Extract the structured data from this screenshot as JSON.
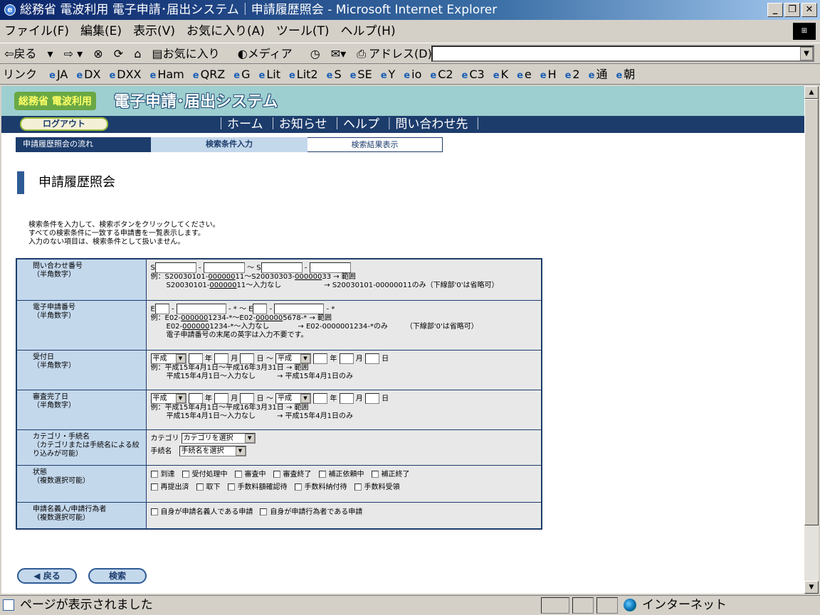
{
  "window": {
    "title": "総務省 電波利用 電子申請･届出システム｜申請履歴照会 - Microsoft Internet Explorer"
  },
  "menu": [
    "ファイル(F)",
    "編集(E)",
    "表示(V)",
    "お気に入り(A)",
    "ツール(T)",
    "ヘルプ(H)"
  ],
  "toolbar": {
    "back": "戻る",
    "favorites": "お気に入り",
    "media": "メディア",
    "address_label": "アドレス(D)",
    "address_value": ""
  },
  "links": {
    "label": "リンク",
    "items": [
      "JA",
      "DX",
      "DXX",
      "Ham",
      "QRZ",
      "G",
      "Lit",
      "Lit2",
      "S",
      "SE",
      "Y",
      "io",
      "C2",
      "C3",
      "K",
      "e",
      "H",
      "2",
      "通",
      "朝"
    ]
  },
  "site": {
    "logo_small_a": "総務省",
    "logo_small_b": "電波利用",
    "logo_main": "電子申請･届出システム",
    "logout": "ログアウト",
    "nav": "｜ホーム ｜お知らせ ｜ヘルプ ｜問い合わせ先 ｜"
  },
  "flow": {
    "s1": "申請履歴照会の流れ",
    "s2": "検索条件入力",
    "s3": "検索結果表示"
  },
  "page": {
    "title": "申請履歴照会",
    "intro": [
      "検索条件を入力して、検索ボタンをクリックしてください。",
      "すべての検索条件に一致する申請書を一覧表示します。",
      "入力のない項目は、検索条件として扱いません。"
    ]
  },
  "form": {
    "inquiry": {
      "label": "問い合わせ番号",
      "sub": "（半角数字）",
      "p": "S",
      "tilde": "～",
      "ex1": "例：S20030101-",
      "ex1u": "000000",
      "ex1b": "11～S20030303-",
      "ex1u2": "000000",
      "ex1c": "33 → 範囲",
      "ex2a": "S20030101-",
      "ex2u": "000000",
      "ex2b": "11～入力なし　　　　　　→ S20030101-00000011のみ（下線部'0'は省略可）"
    },
    "eapp": {
      "label": "電子申請番号",
      "sub": "（半角数字）",
      "mid": "- * ～ E",
      "p": "E",
      "tail": "- *",
      "ex1": "例：E02-",
      "ex1u": "000000",
      "ex1b": "1234-*～E02-",
      "ex1u2": "000000",
      "ex1c": "5678-* → 範囲",
      "ex2a": "E02-",
      "ex2u": "000000",
      "ex2b": "1234-*～入力なし　　　　→ E02-0000001234-*のみ　　　（下線部'0'は省略可）",
      "note": "電子申請番号の末尾の英字は入力不要です。"
    },
    "receipt": {
      "label": "受付日",
      "sub": "（半角数字）",
      "era": "平成",
      "y": "年",
      "m": "月",
      "d": "日",
      "tilde": "～",
      "ex1": "例：平成15年4月1日～平成16年3月31日 → 範囲",
      "ex2": "平成15年4月1日～入力なし　　　→ 平成15年4月1日のみ"
    },
    "review": {
      "label": "審査完了日",
      "sub": "（半角数字）",
      "era": "平成",
      "y": "年",
      "m": "月",
      "d": "日",
      "tilde": "～",
      "ex1": "例：平成15年4月1日～平成16年3月31日 → 範囲",
      "ex2": "平成15年4月1日～入力なし　　　→ 平成15年4月1日のみ"
    },
    "category": {
      "label": "カテゴリ・手続名",
      "sub": "（カテゴリまたは手続名による絞り込みが可能）",
      "cat_label": "カテゴリ",
      "cat_value": "カテゴリを選択",
      "proc_label": "手続名",
      "proc_value": "手続名を選択"
    },
    "status": {
      "label": "状態",
      "sub": "（複数選択可能）",
      "row1": [
        "到達",
        "受付処理中",
        "審査中",
        "審査終了",
        "補正依頼中",
        "補正終了"
      ],
      "row2": [
        "再提出済",
        "取下",
        "手数料額確認待",
        "手数料納付待",
        "手数料受領"
      ]
    },
    "applicant": {
      "label": "申請名義人/申請行為者",
      "sub": "（複数選択可能）",
      "opts": [
        "自身が申請名義人である申請",
        "自身が申請行為者である申請"
      ]
    }
  },
  "buttons": {
    "back": "◀ 戻る",
    "search": "検索"
  },
  "status_bar": {
    "text": "ページが表示されました",
    "zone": "インターネット"
  }
}
